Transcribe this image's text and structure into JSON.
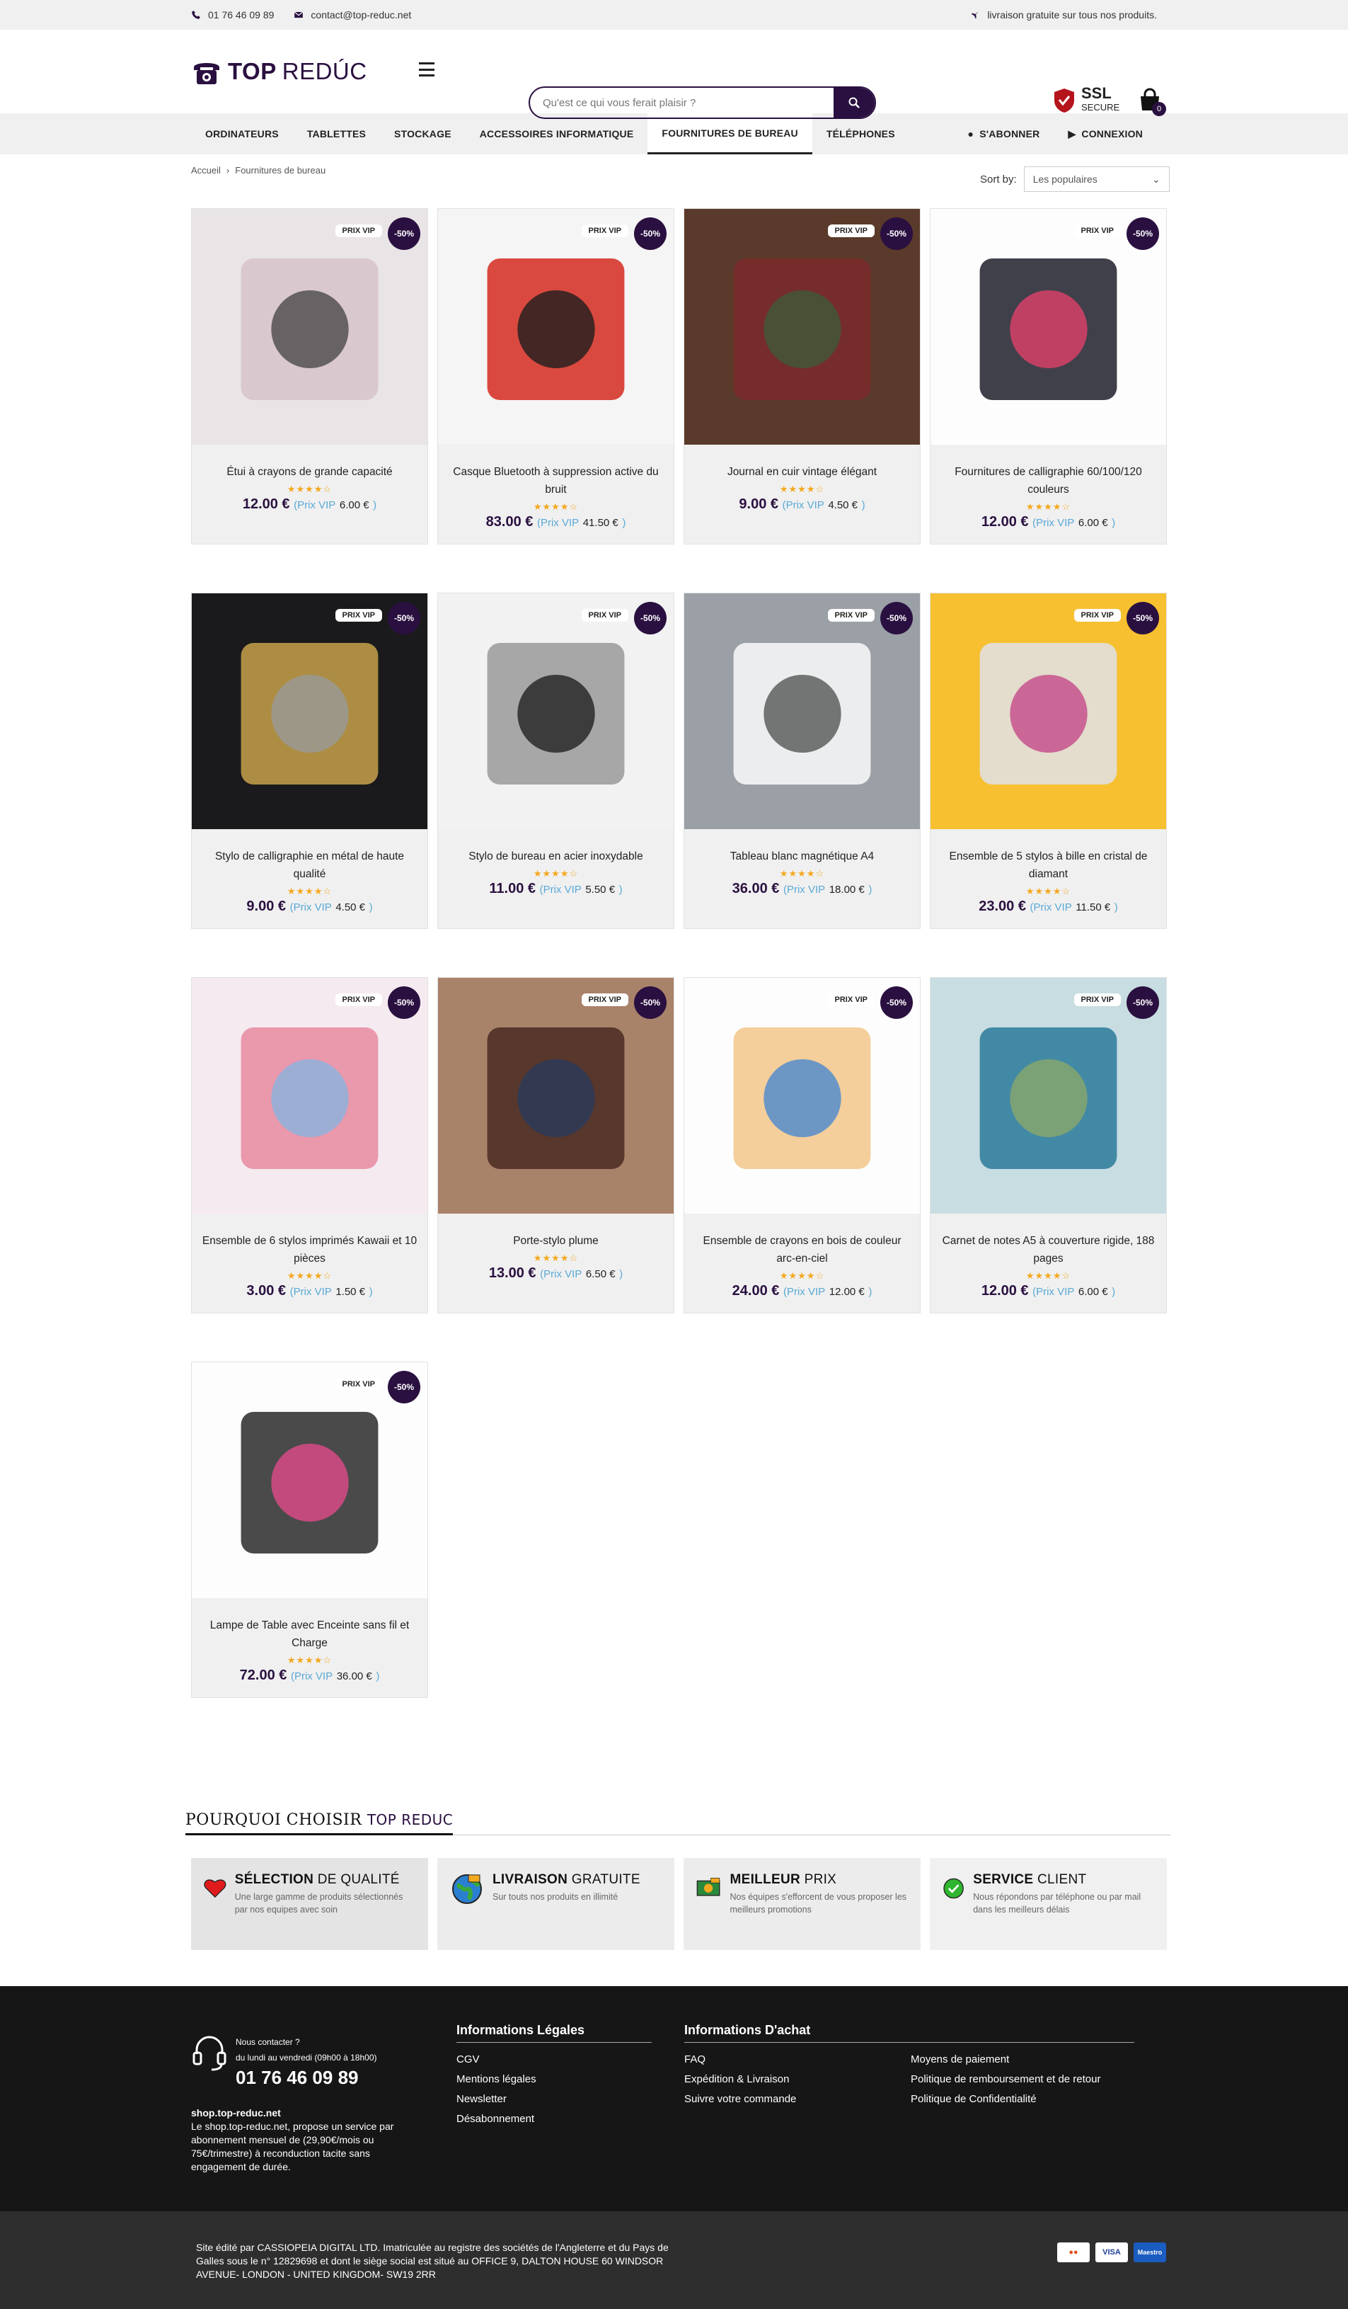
{
  "topbar": {
    "phone": "01 76 46 09 89",
    "email": "contact@top-reduc.net",
    "shipping": "livraison gratuite sur tous nos produits."
  },
  "header": {
    "logo_strong": "TOP",
    "logo_light": "REDÚC",
    "search_placeholder": "Qu'est ce qui vous ferait plaisir ?",
    "ssl_title": "SSL",
    "ssl_sub": "SECURE",
    "cart_count": "0"
  },
  "nav": {
    "items": [
      "ORDINATEURS",
      "TABLETTES",
      "STOCKAGE",
      "ACCESSOIRES INFORMATIQUE",
      "FOURNITURES DE BUREAU",
      "TÉLÉPHONES"
    ],
    "active": 4,
    "subscribe": "S'ABONNER",
    "login": "CONNEXION"
  },
  "breadcrumb": {
    "home": "Accueil",
    "sep": "›",
    "current": "Fournitures de bureau"
  },
  "sort": {
    "label": "Sort by:",
    "value": "Les populaires"
  },
  "badges": {
    "vip": "PRIX VIP",
    "discount": "-50%",
    "vip_word": "Prix VIP",
    "stars": "★★★★☆"
  },
  "products": [
    {
      "name": "Étui à crayons de grande capacité",
      "price": "12.00 €",
      "vip": "6.00 €",
      "icon": "pencil-case"
    },
    {
      "name": "Casque Bluetooth à suppression active du bruit",
      "price": "83.00 €",
      "vip": "41.50 €",
      "icon": "headphones"
    },
    {
      "name": "Journal en cuir vintage élégant",
      "price": "9.00 €",
      "vip": "4.50 €",
      "icon": "leather-journal"
    },
    {
      "name": "Fournitures de calligraphie 60/100/120 couleurs",
      "price": "12.00 €",
      "vip": "6.00 €",
      "icon": "calligraphy-markers"
    },
    {
      "name": "Stylo de calligraphie en métal de haute qualité",
      "price": "9.00 €",
      "vip": "4.50 €",
      "icon": "fountain-pens"
    },
    {
      "name": "Stylo de bureau en acier inoxydable",
      "price": "11.00 €",
      "vip": "5.50 €",
      "icon": "steel-pen"
    },
    {
      "name": "Tableau blanc magnétique A4",
      "price": "36.00 €",
      "vip": "18.00 €",
      "icon": "whiteboard"
    },
    {
      "name": "Ensemble de 5 stylos à bille en cristal de diamant",
      "price": "23.00 €",
      "vip": "11.50 €",
      "icon": "crystal-pens"
    },
    {
      "name": "Ensemble de 6 stylos imprimés Kawaii et 10 pièces",
      "price": "3.00 €",
      "vip": "1.50 €",
      "icon": "kawaii-pens"
    },
    {
      "name": "Porte-stylo plume",
      "price": "13.00 €",
      "vip": "6.50 €",
      "icon": "pen-holder"
    },
    {
      "name": "Ensemble de crayons en bois de couleur arc-en-ciel",
      "price": "24.00 €",
      "vip": "12.00 €",
      "icon": "rainbow-pencils"
    },
    {
      "name": "Carnet de notes A5 à couverture rigide, 188 pages",
      "price": "12.00 €",
      "vip": "6.00 €",
      "icon": "notebooks"
    },
    {
      "name": "Lampe de Table avec Enceinte sans fil et Charge",
      "price": "72.00 €",
      "vip": "36.00 €",
      "icon": "desk-lamp"
    }
  ],
  "why": {
    "title_a": "POURQUOI CHOISIR",
    "title_b": "TOP REDUC",
    "features": [
      {
        "strong": "SÉLECTION",
        "light": "DE QUALITÉ",
        "desc": "Une large gamme de produits sélectionnés par nos equipes avec soin"
      },
      {
        "strong": "LIVRAISON",
        "light": "GRATUITE",
        "desc": "Sur touts nos produits en illimité"
      },
      {
        "strong": "MEILLEUR",
        "light": "PRIX",
        "desc": "Nos équipes s'efforcent de vous proposer les meilleurs promotions"
      },
      {
        "strong": "SERVICE",
        "light": "CLIENT",
        "desc": "Nous répondons par téléphone ou par mail dans les meilleurs délais"
      }
    ]
  },
  "footer": {
    "contact_q": "Nous contacter ?",
    "hours": "du lundi au vendredi (09h00 à 18h00)",
    "phone": "01 76 46 09 89",
    "site": "shop.top-reduc.net",
    "site_desc": "Le shop.top-reduc.net, propose un service par abonnement mensuel de (29,90€/mois ou 75€/trimestre) à reconduction tacite sans engagement de durée.",
    "legal_title": "Informations Légales",
    "legal": [
      "CGV",
      "Mentions légales",
      "Newsletter",
      "Désabonnement"
    ],
    "buy_title": "Informations D'achat",
    "buy_a": [
      "FAQ",
      "Expédition & Livraison",
      "Suivre votre commande"
    ],
    "buy_b": [
      "Moyens de paiement",
      "Politique de remboursement et de retour",
      "Politique de Confidentialité"
    ],
    "company": "Site édité par CASSIOPEIA DIGITAL LTD. Imatriculée au registre des sociétés de l'Angleterre et du Pays de Galles sous le n° 12829698 et dont le siège social est situé au OFFICE 9, DALTON HOUSE 60 WINDSOR AVENUE- LONDON - UNITED KINGDOM- SW19 2RR",
    "pay": [
      "MC",
      "VISA",
      "Maestro"
    ]
  },
  "colors": {
    "brand": "#2a1040",
    "vip": "#5aa9d6",
    "star": "#f4a81d"
  }
}
